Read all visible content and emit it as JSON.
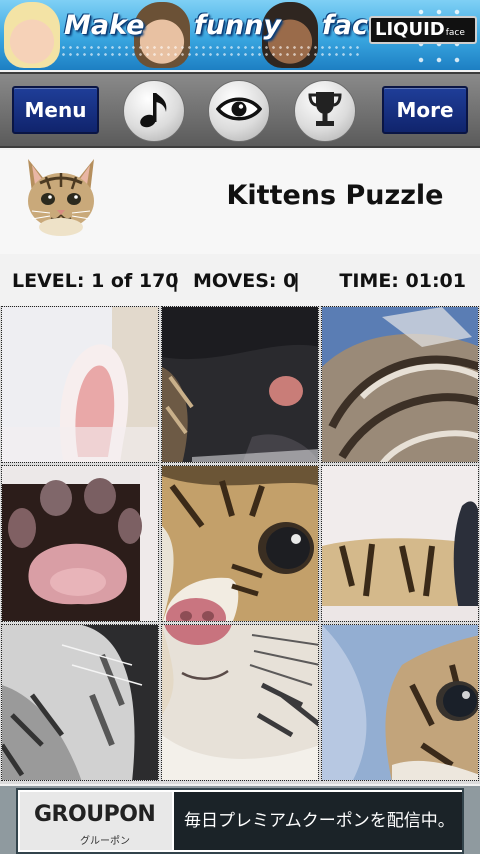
{
  "top_ad": {
    "words": [
      "Make",
      "funny",
      "faces"
    ],
    "logo_text": "LIQUID",
    "logo_sub": "face"
  },
  "toolbar": {
    "menu_label": "Menu",
    "more_label": "More",
    "icons": [
      "music-note-icon",
      "eye-icon",
      "trophy-icon"
    ]
  },
  "header": {
    "title": "Kittens Puzzle"
  },
  "stats": {
    "level": "LEVEL: 1 of 170",
    "separator": "|",
    "moves": "MOVES: 0",
    "time": "TIME: 01:01"
  },
  "puzzle": {
    "rows": 3,
    "cols": 3
  },
  "bottom_ad": {
    "brand": "GROUPON",
    "brand_kana": "グルーポン",
    "message": "毎日プレミアムクーポンを配信中。"
  },
  "colors": {
    "toolbar_button": "#1f3e99",
    "banner_blue": "#39a6e0"
  }
}
